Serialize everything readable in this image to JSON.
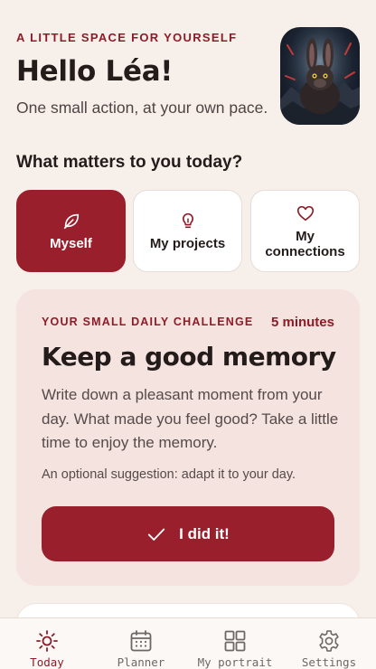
{
  "header": {
    "eyebrow": "A LITTLE SPACE FOR YOURSELF",
    "greeting": "Hello Léa!",
    "tagline": "One small action, at your own pace."
  },
  "avatar": {
    "alt": "rabbit-portrait"
  },
  "section": {
    "title": "What matters to you today?"
  },
  "categories": [
    {
      "label": "Myself",
      "icon": "leaf-icon",
      "active": true
    },
    {
      "label": "My projects",
      "icon": "lightbulb-icon",
      "active": false
    },
    {
      "label": "My connections",
      "icon": "heart-icon",
      "active": false
    }
  ],
  "challenge": {
    "eyebrow": "YOUR SMALL DAILY CHALLENGE",
    "duration": "5 minutes",
    "title": "Keep a good memory",
    "body": "Write down a pleasant moment from your day. What made you feel good? Take a little time to enjoy the memory.",
    "note": "An optional suggestion: adapt it to your day.",
    "button_label": "I did it!"
  },
  "tabs": [
    {
      "label": "Today",
      "icon": "sun-icon",
      "active": true
    },
    {
      "label": "Planner",
      "icon": "calendar-icon",
      "active": false
    },
    {
      "label": "My portrait",
      "icon": "grid-icon",
      "active": false
    },
    {
      "label": "Settings",
      "icon": "gear-icon",
      "active": false
    }
  ],
  "colors": {
    "accent": "#981f2b",
    "background": "#f6efea",
    "challenge_bg": "#f4e3df"
  }
}
